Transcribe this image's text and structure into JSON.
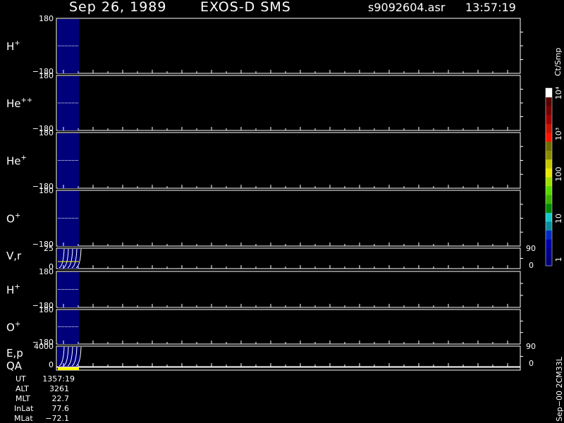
{
  "header": {
    "date": "Sep 26, 1989",
    "instrument": "EXOS-D SMS",
    "filename": "s9092604.asr",
    "time": "13:57:19"
  },
  "panels": [
    {
      "key": "h1",
      "species": "H",
      "charge": "+",
      "ytop": "180",
      "ybot": "−180"
    },
    {
      "key": "he2",
      "species": "He",
      "charge": "++",
      "ytop": "180",
      "ybot": "−180"
    },
    {
      "key": "he1",
      "species": "He",
      "charge": "+",
      "ytop": "180",
      "ybot": "−180"
    },
    {
      "key": "o1",
      "species": "O",
      "charge": "+",
      "ytop": "180",
      "ybot": "−180"
    },
    {
      "key": "vr",
      "label": "V,r",
      "ytop": "25",
      "ybot": "0",
      "rtop": "90",
      "rbot": "0"
    },
    {
      "key": "h2",
      "species": "H",
      "charge": "+",
      "ytop": "180",
      "ybot": "−180"
    },
    {
      "key": "o2",
      "species": "O",
      "charge": "+",
      "ytop": "180",
      "ybot": "−180"
    },
    {
      "key": "ep",
      "label": "E,p",
      "ytop": "4000",
      "ybot": "0",
      "rtop": "90",
      "rbot": "0"
    },
    {
      "key": "qa",
      "label": "QA"
    }
  ],
  "footer": {
    "labels": [
      "UT",
      "ALT",
      "MLT",
      "InLat",
      "MLat"
    ],
    "values": [
      "1357:19",
      "3261",
      "22.7",
      "77.6",
      "−72.1"
    ]
  },
  "colorbar": {
    "unit": "Ct/Smp",
    "labels": [
      "1",
      "10",
      "100",
      "10³",
      "10⁴"
    ],
    "colors": [
      "#00007a",
      "#00008c",
      "#0000a8",
      "#0028c8",
      "#0c8c9c",
      "#18c8c8",
      "#008a00",
      "#3cb400",
      "#58d800",
      "#a0e000",
      "#e8e800",
      "#c8c800",
      "#8c8c00",
      "#6e6e00",
      "#ff1400",
      "#c81400",
      "#a00000",
      "#780000",
      "#5a0000",
      "#ffffff"
    ]
  },
  "right_note": "Sep−00 2CM33L",
  "colors": {
    "background": "#000000",
    "axes": "#ffffff",
    "data_bg": "#00007a",
    "qa": "#ffff00"
  }
}
